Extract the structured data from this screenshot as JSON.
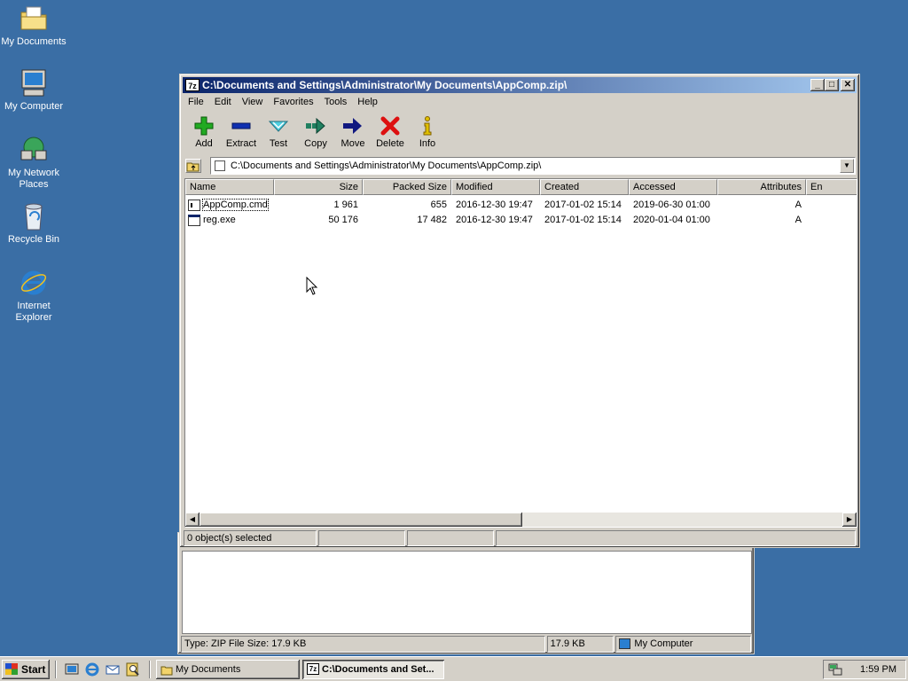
{
  "desktop": {
    "icons": [
      {
        "label": "My Documents",
        "icon": "folder-documents-icon"
      },
      {
        "label": "My Computer",
        "icon": "computer-icon"
      },
      {
        "label": "My Network Places",
        "icon": "network-icon"
      },
      {
        "label": "Recycle Bin",
        "icon": "recycle-bin-icon"
      },
      {
        "label": "Internet Explorer",
        "icon": "internet-explorer-icon"
      }
    ]
  },
  "bg_window": {
    "status": {
      "type": "Type: ZIP File Size: 17.9 KB",
      "size": "17.9 KB",
      "zone": "My Computer"
    }
  },
  "main_window": {
    "title": "C:\\Documents and Settings\\Administrator\\My Documents\\AppComp.zip\\",
    "title_icon_text": "7z",
    "menu": [
      "File",
      "Edit",
      "View",
      "Favorites",
      "Tools",
      "Help"
    ],
    "toolbar": [
      {
        "label": "Add",
        "icon": "add-icon",
        "color": "#22aa22"
      },
      {
        "label": "Extract",
        "icon": "extract-icon",
        "color": "#1030b0"
      },
      {
        "label": "Test",
        "icon": "test-icon",
        "color": "#30b0c0"
      },
      {
        "label": "Copy",
        "icon": "copy-icon",
        "color": "#208060"
      },
      {
        "label": "Move",
        "icon": "move-icon",
        "color": "#101880"
      },
      {
        "label": "Delete",
        "icon": "delete-icon",
        "color": "#dd1010"
      },
      {
        "label": "Info",
        "icon": "info-icon",
        "color": "#c0a000"
      }
    ],
    "address": "C:\\Documents and Settings\\Administrator\\My Documents\\AppComp.zip\\",
    "columns": [
      "Name",
      "Size",
      "Packed Size",
      "Modified",
      "Created",
      "Accessed",
      "Attributes",
      "En"
    ],
    "rows": [
      {
        "name": "AppComp.cmd",
        "size": "1 961",
        "packed": "655",
        "modified": "2016-12-30 19:47",
        "created": "2017-01-02 15:14",
        "accessed": "2019-06-30 01:00",
        "attributes": "A",
        "icon": "cmd-file-icon"
      },
      {
        "name": "reg.exe",
        "size": "50 176",
        "packed": "17 482",
        "modified": "2016-12-30 19:47",
        "created": "2017-01-02 15:14",
        "accessed": "2020-01-04 01:00",
        "attributes": "A",
        "icon": "exe-file-icon"
      }
    ],
    "status": "0 object(s) selected"
  },
  "taskbar": {
    "start_label": "Start",
    "buttons": [
      {
        "label": "My Documents",
        "active": false
      },
      {
        "label": "C:\\Documents and Set...",
        "active": true
      }
    ],
    "clock": "1:59 PM"
  },
  "colors": {
    "desktop": "#3a6ea5",
    "titlebar_start": "#0a246a",
    "titlebar_end": "#a6caf0",
    "face": "#d4d0c8"
  }
}
